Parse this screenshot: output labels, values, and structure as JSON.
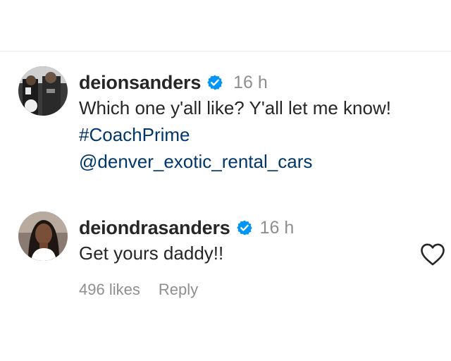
{
  "comments": [
    {
      "username": "deionsanders",
      "time": "16 h",
      "text": "Which one y'all like? Y'all let me know!",
      "hashtag": "#CoachPrime",
      "mention": "@denver_exotic_rental_cars"
    },
    {
      "username": "deiondrasanders",
      "time": "16 h",
      "text": "Get yours daddy!!",
      "likes": "496 likes",
      "reply_label": "Reply"
    }
  ],
  "icons": {
    "verified": "verified-badge-icon",
    "like": "heart-outline-icon"
  },
  "colors": {
    "text": "#262626",
    "muted": "#8e8e8e",
    "link": "#00376b",
    "verified": "#0095f6"
  }
}
